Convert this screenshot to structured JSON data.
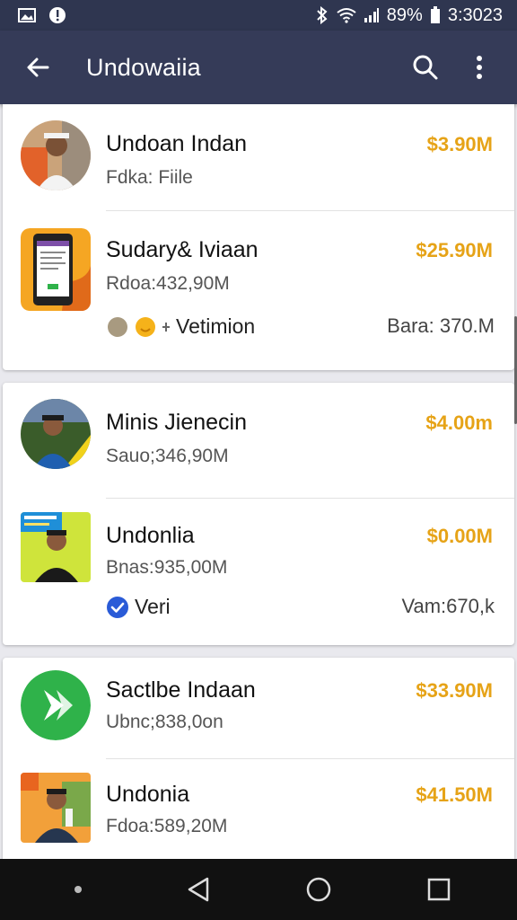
{
  "status_bar": {
    "battery": "89%",
    "time": "3:3023"
  },
  "app_bar": {
    "title": "Undowaiia"
  },
  "items": [
    {
      "name": "Undoan Indan",
      "sub": "Fdka: Fiile",
      "price": "$3.90M"
    },
    {
      "name": "Sudary& Iviaan",
      "sub": "Rdoa:432,90M",
      "price": "$25.90M"
    },
    {
      "name": "Minis Jienecin",
      "sub": "Sauo;346,90M",
      "price": "$4.00m"
    },
    {
      "name": "Undonlia",
      "sub": "Bnas:935,00M",
      "price": "$0.00M"
    },
    {
      "name": "Sactlbe Indaan",
      "sub": "Ubnc;838,0on",
      "price": "$33.90M"
    },
    {
      "name": "Undonia",
      "sub": "Fdoa:589,20M",
      "price": "$41.50M"
    }
  ],
  "meta": [
    {
      "label": "Vetimion",
      "value": "Bara: 370.M"
    },
    {
      "label": "Veri",
      "value": "Vam:670,k"
    }
  ],
  "colors": {
    "app_bar": "#353b58",
    "price": "#e6a317",
    "verified": "#2a5bd7",
    "green_app": "#2fb24a"
  },
  "icons": {
    "back": "arrow-left-icon",
    "search": "search-icon",
    "more": "more-vert-icon"
  }
}
